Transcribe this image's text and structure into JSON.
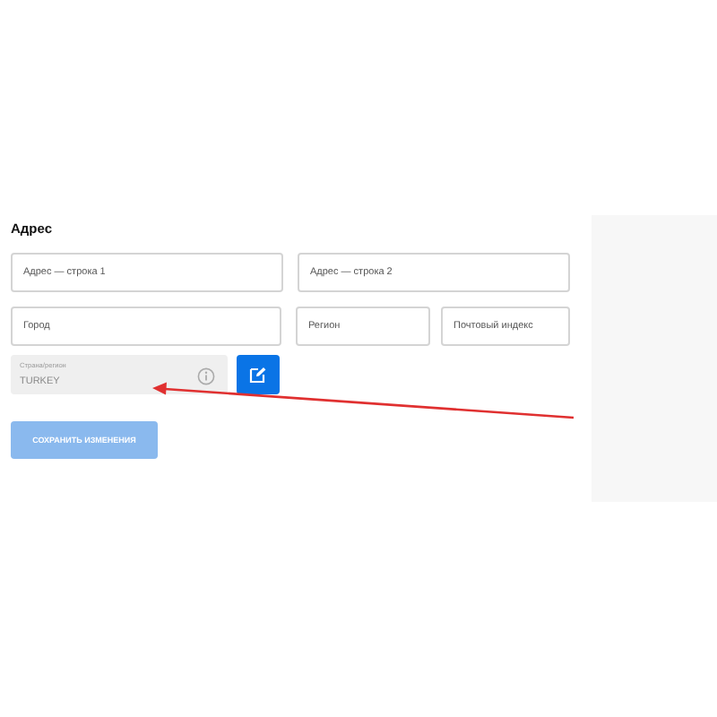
{
  "section_title": "Адрес",
  "address_fields": [
    {
      "placeholder": "Адрес — строка 1"
    },
    {
      "placeholder": "Адрес — строка 2"
    }
  ],
  "location_fields": [
    {
      "placeholder": "Город"
    },
    {
      "placeholder": "Регион"
    },
    {
      "placeholder": "Почтовый индекс"
    }
  ],
  "country_field": {
    "label": "Страна/регион",
    "value": "TURKEY",
    "disabled": true
  },
  "save_button": {
    "label": "СОХРАНИТЬ ИЗМЕНЕНИЯ",
    "disabled": true
  }
}
